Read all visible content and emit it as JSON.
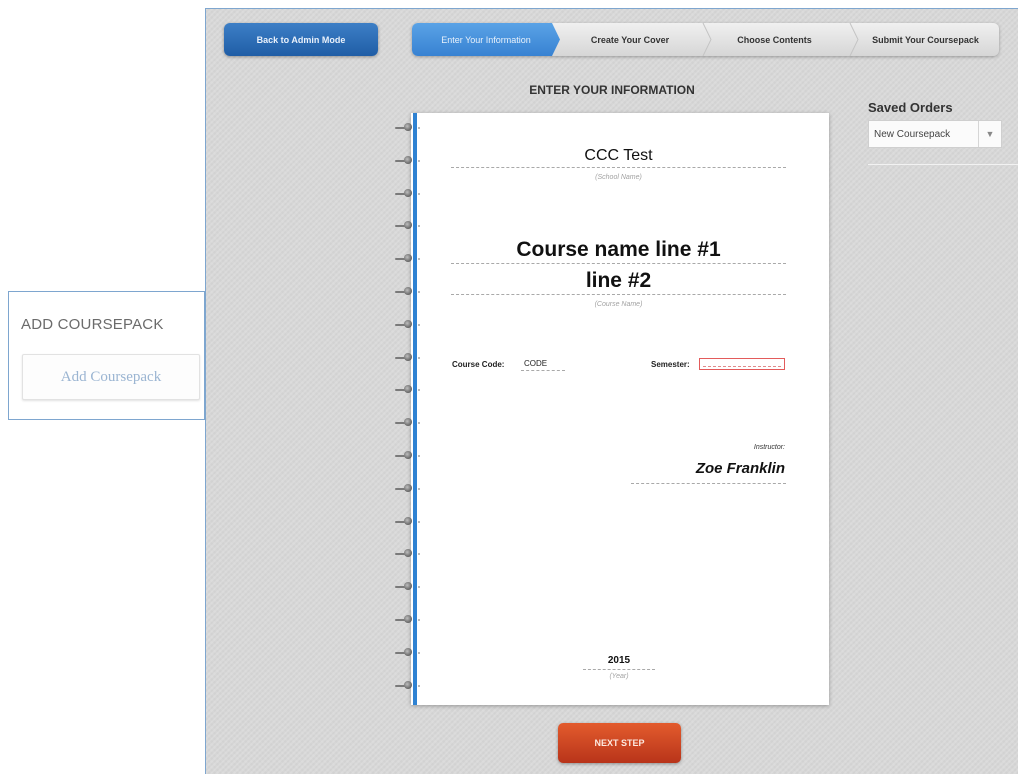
{
  "callout": {
    "title": "ADD COURSEPACK",
    "button_label": "Add Coursepack"
  },
  "toolbar": {
    "admin_button_label": "Back to Admin Mode"
  },
  "steps": [
    {
      "label": "Enter Your Information",
      "active": true
    },
    {
      "label": "Create Your Cover",
      "active": false
    },
    {
      "label": "Choose Contents",
      "active": false
    },
    {
      "label": "Submit Your Coursepack",
      "active": false
    }
  ],
  "page": {
    "heading": "ENTER YOUR INFORMATION"
  },
  "saved_orders": {
    "label": "Saved Orders",
    "selected": "New Coursepack",
    "dropdown_icon": "caret-down-icon"
  },
  "cover": {
    "school_name": "CCC Test",
    "school_hint": "(School Name)",
    "course_line1": "Course name line #1",
    "course_line2": "line #2",
    "course_hint": "(Course Name)",
    "course_code_label": "Course Code:",
    "course_code_value": "CODE",
    "semester_label": "Semester:",
    "semester_value": "",
    "instructor_label": "Instructor:",
    "instructor_name": "Zoe Franklin",
    "year": "2015",
    "year_hint": "(Year)"
  },
  "actions": {
    "next_label": "NEXT STEP"
  },
  "colors": {
    "accent_blue": "#2f82d2",
    "next_orange": "#c8401f",
    "error_red": "#e35b5b"
  }
}
